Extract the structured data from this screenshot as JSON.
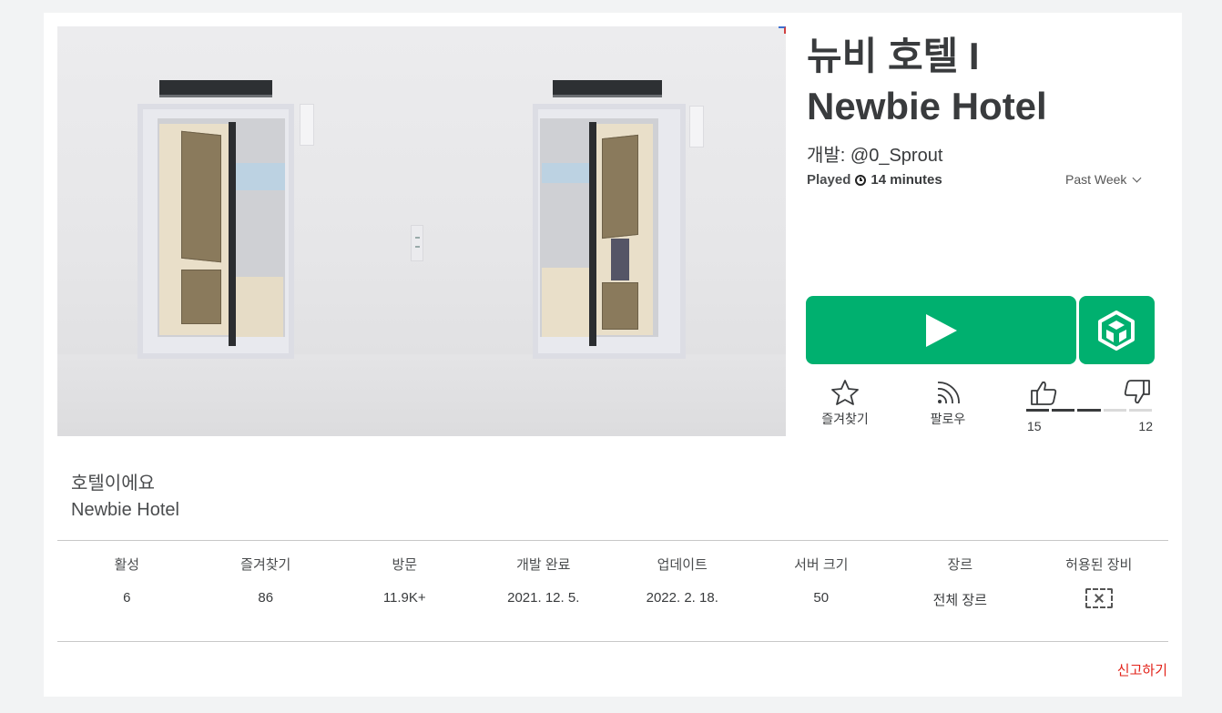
{
  "game": {
    "title_line1": "뉴비 호텔 I",
    "title_line2": "Newbie Hotel",
    "creator": "개발: @0_Sprout",
    "played_label": "Played",
    "played_value": "14 minutes",
    "period_select": "Past Week"
  },
  "actions": {
    "favorite_label": "즐겨찾기",
    "follow_label": "팔로우",
    "upvotes": "15",
    "downvotes": "12",
    "upvote_fraction": 0.556
  },
  "description": {
    "line1": "호텔이에요",
    "line2": "Newbie Hotel"
  },
  "stats": [
    {
      "label": "활성",
      "value": "6"
    },
    {
      "label": "즐겨찾기",
      "value": "86"
    },
    {
      "label": "방문",
      "value": "11.9K+"
    },
    {
      "label": "개발 완료",
      "value": "2021. 12. 5."
    },
    {
      "label": "업데이트",
      "value": "2022. 2. 18."
    },
    {
      "label": "서버 크기",
      "value": "50"
    },
    {
      "label": "장르",
      "value": "전체 장르"
    },
    {
      "label": "허용된 장비",
      "value": ""
    }
  ],
  "report_label": "신고하기",
  "icons": {
    "play": "play-icon",
    "cube": "cube-icon",
    "star": "star-icon",
    "follow": "rss-icon",
    "thumb_up": "thumbs-up-icon",
    "thumb_down": "thumbs-down-icon",
    "clock": "clock-icon",
    "gear_none": "no-gear-icon"
  },
  "colors": {
    "play_green": "#00b06f",
    "report_red": "#e2231a",
    "vote_filled": "#393b3d",
    "vote_empty": "#dadada"
  }
}
